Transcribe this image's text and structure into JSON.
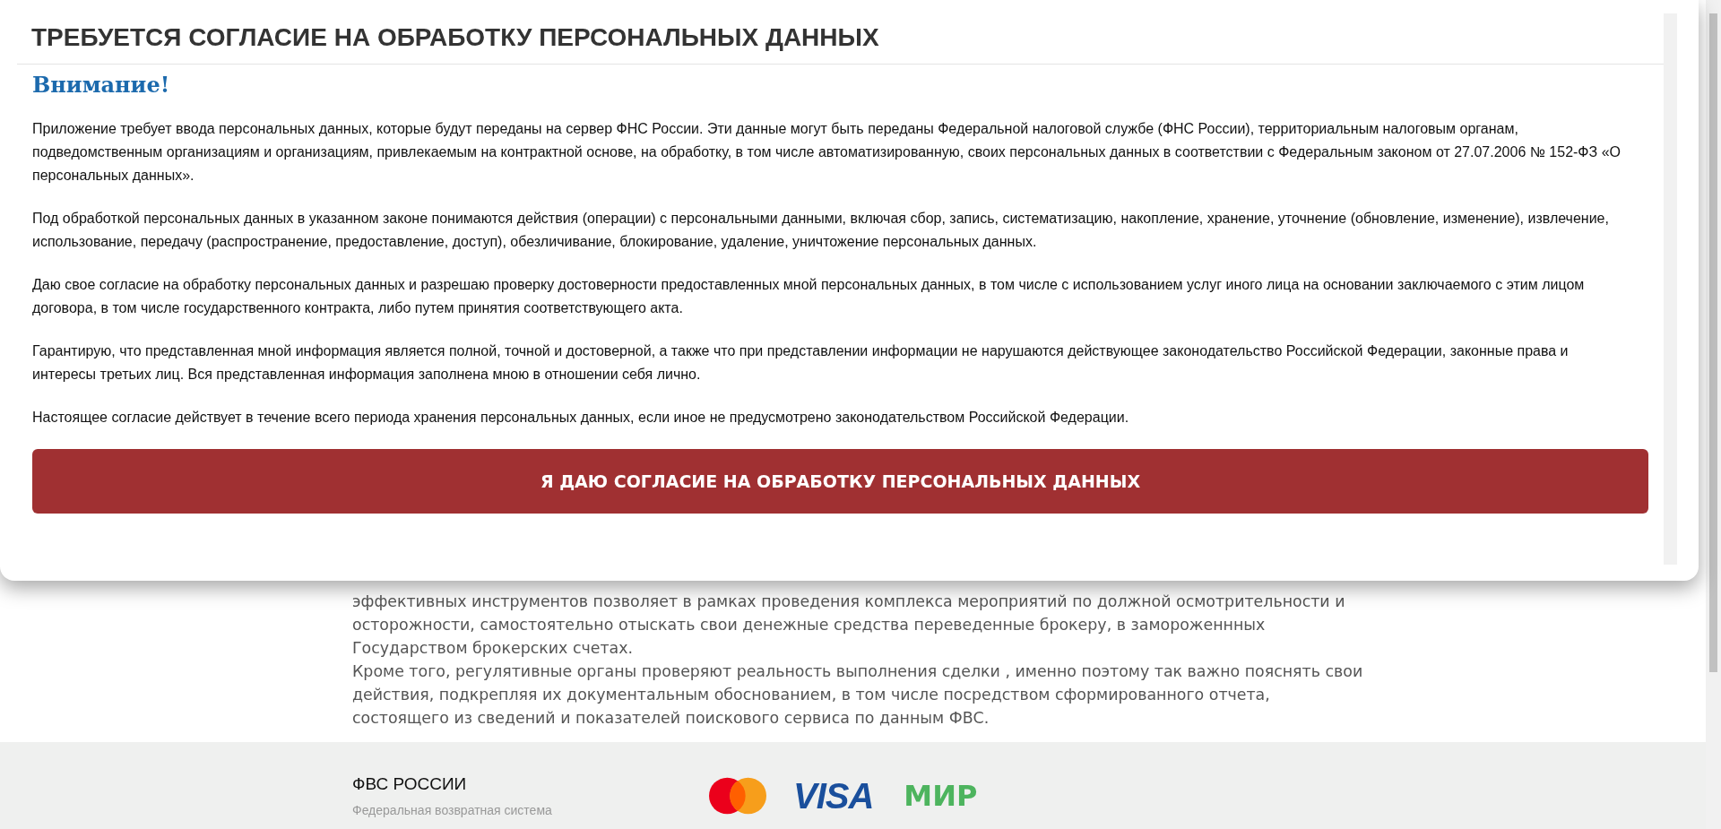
{
  "modal": {
    "title": "ТРЕБУЕТСЯ СОГЛАСИЕ НА ОБРАБОТКУ ПЕРСОНАЛЬНЫХ ДАННЫХ",
    "notice": "Внимание!",
    "paragraphs": [
      "Приложение требует ввода персональных данных, которые будут переданы на сервер ФНС России. Эти данные могут быть переданы Федеральной налоговой службе (ФНС России), территориальным налоговым органам, подведомственным организациям и организациям, привлекаемым на контрактной основе, на обработку, в том числе автоматизированную, своих персональных данных в соответствии с Федеральным законом от 27.07.2006 № 152-ФЗ «О персональных данных».",
      "Под обработкой персональных данных в указанном законе понимаются действия (операции) с персональными данными, включая сбор, запись, систематизацию, накопление, хранение, уточнение (обновление, изменение), извлечение, использование, передачу (распространение, предоставление, доступ), обезличивание, блокирование, удаление, уничтожение персональных данных.",
      "Даю свое согласие на обработку персональных данных и разрешаю проверку достоверности предоставленных мной персональных данных, в том числе с использованием услуг иного лица на основании заключаемого с этим лицом договора, в том числе государственного контракта, либо путем принятия соответствующего акта.",
      "Гарантирую, что представленная мной информация является полной, точной и достоверной, а также что при представлении информации не нарушаются действующее законодательство Российской Федерации, законные права и интересы третьих лиц. Вся представленная информация заполнена мною в отношении себя лично.",
      "Настоящее согласие действует в течение всего периода хранения персональных данных, если иное не предусмотрено законодательством Российской Федерации."
    ],
    "button": "Я ДАЮ СОГЛАСИЕ НА ОБРАБОТКУ ПЕРСОНАЛЬНЫХ ДАННЫХ"
  },
  "page": {
    "paragraphs": [
      "эффективных инструментов позволяет в рамках проведения комплекса мероприятий по должной осмотрительности и осторожности, самостоятельно отыскать свои денежные средства переведенные брокеру, в замороженнных Государством брокерских счетах.",
      "Кроме того, регулятивные органы проверяют реальность выполнения сделки , именно поэтому так важно пояснять свои действия, подкрепляя их документальным обоснованием, в том числе посредством сформированного отчета, состоящего из сведений и показателей поискового сервиса по данным ФВС."
    ]
  },
  "footer": {
    "brand": "ФВС РОССИИ",
    "tagline": "Федеральная возвратная система",
    "payment_logos": [
      {
        "kind": "mastercard"
      },
      {
        "kind": "visa",
        "text": "VISA"
      },
      {
        "kind": "mir",
        "text": "МИР"
      }
    ]
  }
}
